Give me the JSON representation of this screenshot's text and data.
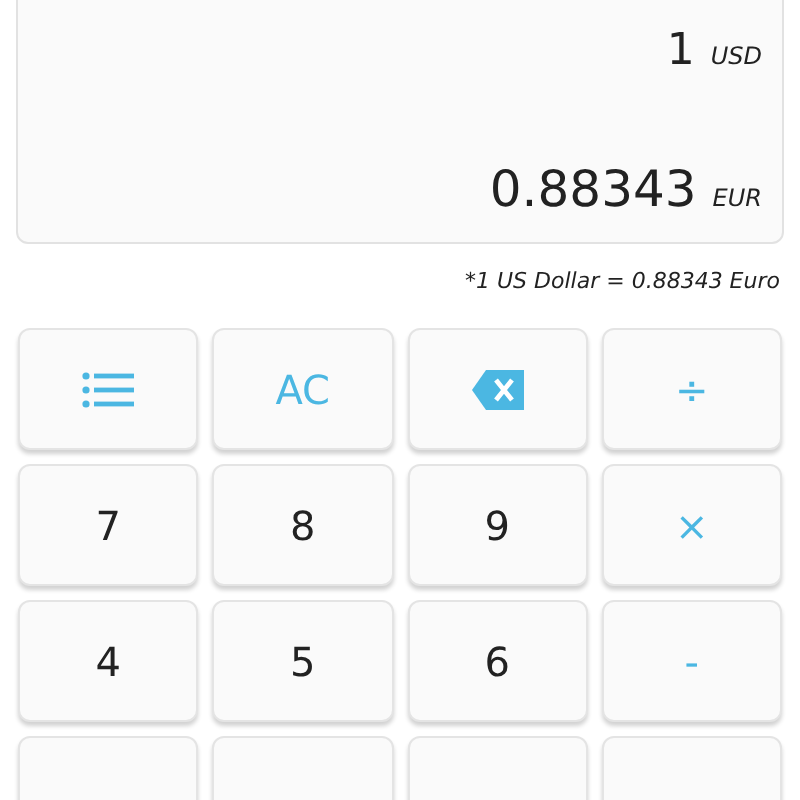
{
  "display": {
    "amounts": [
      {
        "value": "1",
        "currency": "USD"
      },
      {
        "value": "0.88343",
        "currency": "EUR"
      }
    ]
  },
  "rate_note": "*1 US Dollar = 0.88343 Euro",
  "keys": [
    {
      "kind": "menu",
      "accent": true
    },
    {
      "kind": "label",
      "label": "AC",
      "accent": true
    },
    {
      "kind": "backspace",
      "accent": true
    },
    {
      "kind": "label",
      "label": "÷",
      "accent": true
    },
    {
      "kind": "label",
      "label": "7",
      "accent": false
    },
    {
      "kind": "label",
      "label": "8",
      "accent": false
    },
    {
      "kind": "label",
      "label": "9",
      "accent": false
    },
    {
      "kind": "label",
      "label": "×",
      "accent": true
    },
    {
      "kind": "label",
      "label": "4",
      "accent": false
    },
    {
      "kind": "label",
      "label": "5",
      "accent": false
    },
    {
      "kind": "label",
      "label": "6",
      "accent": false
    },
    {
      "kind": "label",
      "label": "-",
      "accent": true
    },
    {
      "kind": "cut"
    },
    {
      "kind": "cut"
    },
    {
      "kind": "cut"
    },
    {
      "kind": "cut"
    }
  ]
}
